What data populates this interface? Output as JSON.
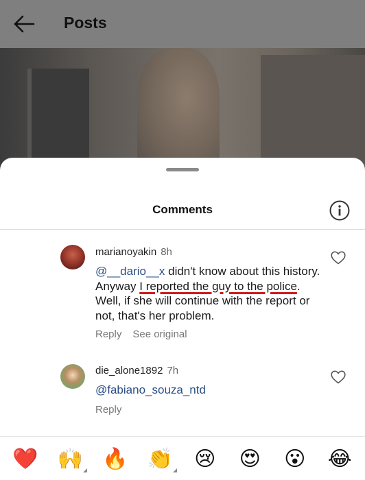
{
  "header": {
    "title": "Posts",
    "back_icon": "arrow-left-icon"
  },
  "sheet": {
    "title": "Comments",
    "info_icon": "info-circle-icon"
  },
  "comments": [
    {
      "username": "marianoyakin",
      "time": "8h",
      "mention": "@__dario__x",
      "text_before": " didn't know about this history. Anyway ",
      "underlined_text": "I reported the guy to the police",
      "text_after": ". Well, if she will continue with the report or not, that's her problem.",
      "reply_label": "Reply",
      "see_original_label": "See original"
    },
    {
      "username": "die_alone1892",
      "time": "7h",
      "mention": "@fabiano_souza_ntd",
      "reply_label": "Reply"
    }
  ],
  "emoji_bar": [
    {
      "name": "red-heart",
      "glyph": "❤️"
    },
    {
      "name": "raising-hands",
      "glyph": "🙌"
    },
    {
      "name": "fire",
      "glyph": "🔥"
    },
    {
      "name": "clapping-hands",
      "glyph": "👏"
    },
    {
      "name": "crying-face",
      "glyph": "😢"
    },
    {
      "name": "heart-eyes",
      "glyph": "😍"
    },
    {
      "name": "astonished-face",
      "glyph": "😮"
    },
    {
      "name": "tears-of-joy",
      "glyph": "😂"
    }
  ],
  "colors": {
    "mention": "#2b4f86",
    "underline": "#d11a1a",
    "topbar": "#7f7f7f"
  }
}
